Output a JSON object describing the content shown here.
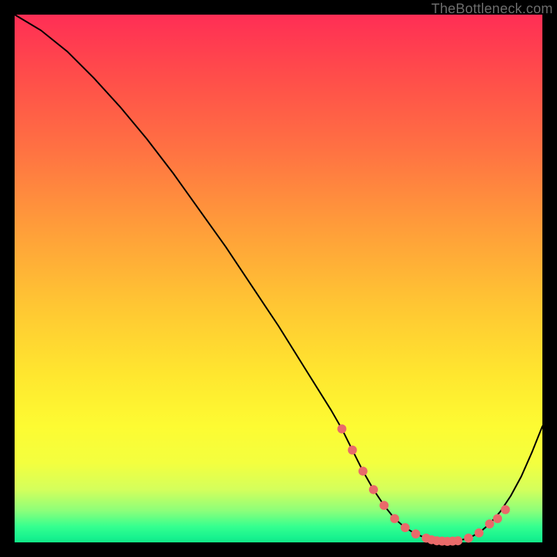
{
  "watermark": {
    "text": "TheBottleneck.com"
  },
  "chart_data": {
    "type": "line",
    "title": "",
    "xlabel": "",
    "ylabel": "",
    "xlim": [
      0,
      100
    ],
    "ylim": [
      0,
      100
    ],
    "series": [
      {
        "name": "bottleneck-curve",
        "x": [
          0,
          5,
          10,
          15,
          20,
          25,
          30,
          35,
          40,
          45,
          50,
          55,
          60,
          62,
          64,
          66,
          68,
          70,
          72,
          74,
          76,
          78,
          80,
          82,
          84,
          86,
          88,
          90,
          92,
          94,
          96,
          98,
          100
        ],
        "y": [
          100,
          97,
          93,
          88,
          82.5,
          76.5,
          70,
          63,
          56,
          48.5,
          41,
          33,
          25,
          21.5,
          17.5,
          13.5,
          10,
          7,
          4.5,
          2.8,
          1.6,
          0.8,
          0.3,
          0.2,
          0.3,
          0.8,
          1.8,
          3.5,
          5.8,
          8.8,
          12.5,
          17,
          22
        ]
      }
    ],
    "markers": {
      "name": "sweet-spot-dots",
      "color": "#e96a6a",
      "x": [
        62,
        64,
        66,
        68,
        70,
        72,
        74,
        76,
        78,
        79,
        80,
        81,
        82,
        83,
        84,
        86,
        88,
        90,
        91.5,
        93
      ],
      "y": [
        21.5,
        17.5,
        13.5,
        10,
        7,
        4.5,
        2.8,
        1.6,
        0.8,
        0.5,
        0.3,
        0.25,
        0.2,
        0.25,
        0.3,
        0.8,
        1.8,
        3.5,
        4.5,
        6.2
      ]
    }
  }
}
